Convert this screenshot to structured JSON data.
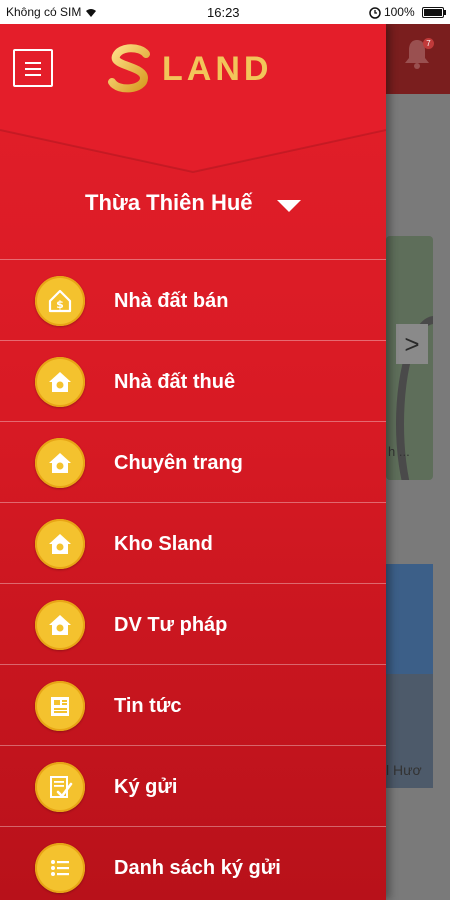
{
  "status_bar": {
    "carrier": "Không có SIM",
    "time": "16:23",
    "battery": "100%",
    "battery_level": 1.0
  },
  "background": {
    "bell_badge": "7",
    "caption_1": "h ...",
    "caption_2": "l Hươ",
    "arrow": ">"
  },
  "drawer": {
    "logo_text": "LAND",
    "region": "Thừa Thiên Huế",
    "items": [
      {
        "label": "Nhà đất bán",
        "icon": "house-dollar-icon"
      },
      {
        "label": "Nhà đất thuê",
        "icon": "house-icon"
      },
      {
        "label": "Chuyên trang",
        "icon": "house-icon"
      },
      {
        "label": "Kho Sland",
        "icon": "house-icon"
      },
      {
        "label": "DV Tư pháp",
        "icon": "house-icon"
      },
      {
        "label": "Tin tức",
        "icon": "newspaper-icon"
      },
      {
        "label": "Ký gửi",
        "icon": "document-check-icon"
      },
      {
        "label": "Danh sách ký gửi",
        "icon": "list-icon"
      }
    ]
  },
  "colors": {
    "drawer_red": "#e31f2a",
    "gold": "#f4c22e",
    "logo_gold": "#f2c55a"
  }
}
